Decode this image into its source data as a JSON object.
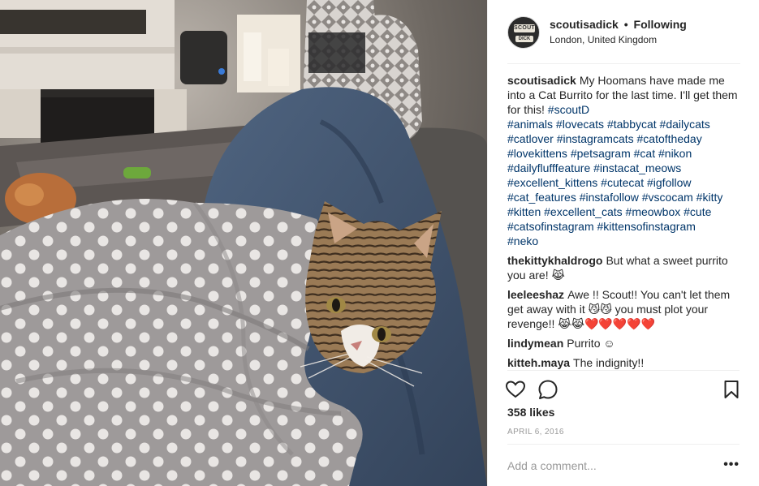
{
  "header": {
    "username": "scoutisadick",
    "separator": "•",
    "follow_status": "Following",
    "location": "London, United Kingdom",
    "avatar_text_top": "SCOUT",
    "avatar_text_bottom": "DICK"
  },
  "caption": {
    "username": "scoutisadick",
    "text": "My Hoomans have made me into a Cat Burrito for the last time. I'll get them for this!",
    "first_tag": "#scoutD",
    "tag_lines": [
      "#animals #lovecats #tabbycat #dailycats",
      "#catlover #instagramcats #catoftheday",
      "#lovekittens #petsagram #cat #nikon",
      "#dailyflufffeature #instacat_meows",
      "#excellent_kittens #cutecat #igfollow",
      "#cat_features #instafollow #vscocam #kitty",
      "#kitten #excellent_cats #meowbox #cute",
      "#catsofinstagram #kittensofinstagram",
      "#neko"
    ]
  },
  "comments": [
    {
      "username": "thekittykhaldrogo",
      "text": "But what a sweet purrito you are! 😹"
    },
    {
      "username": "leeleeshaz",
      "text": "Awe !! Scout!! You can't let them get away with it 😼😼 you must plot your revenge!! 😹😹❤️❤️❤️❤️❤️"
    },
    {
      "username": "lindymean",
      "text": "Purrito ☺"
    },
    {
      "username": "kitteh.maya",
      "text": "The indignity!!"
    }
  ],
  "actions": {
    "like_icon": "heart-icon",
    "comment_icon": "comment-icon",
    "save_icon": "bookmark-icon"
  },
  "likes": "358 likes",
  "date": "APRIL 6, 2016",
  "comment_input": {
    "placeholder": "Add a comment...",
    "value": ""
  },
  "more_options": "•••"
}
